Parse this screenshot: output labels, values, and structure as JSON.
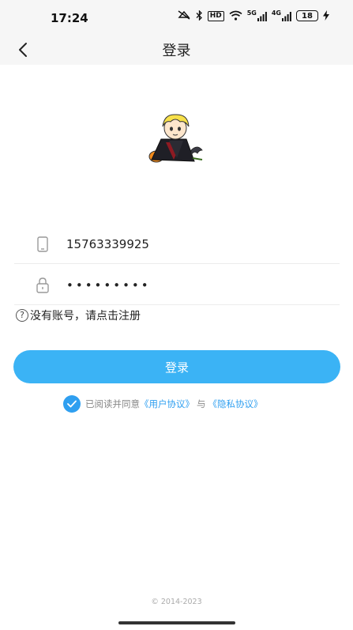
{
  "status_bar": {
    "time": "17:24",
    "network_labels": [
      "HD",
      "5G",
      "4G"
    ],
    "battery": "18",
    "icons": [
      "silent-icon",
      "bluetooth-icon",
      "wifi-icon",
      "signal-icon",
      "charging-icon"
    ]
  },
  "navbar": {
    "title": "登录",
    "back_icon": "chevron-left-icon"
  },
  "form": {
    "phone_value": "15763339925",
    "password_value": "•••••••••",
    "phone_icon": "phone-icon",
    "lock_icon": "lock-icon"
  },
  "register": {
    "text": "没有账号，请点击注册",
    "icon": "question-circle-icon"
  },
  "login_button": "登录",
  "agreement": {
    "checked": true,
    "prefix": "已阅读并同意",
    "user_agreement": "《用户协议》",
    "and": "与",
    "privacy_policy": "《隐私协议》"
  },
  "copyright": "© 2014-2023",
  "colors": {
    "accent": "#3bb3f5",
    "link": "#2f9ff0",
    "bar_bg": "#f6f6f6"
  }
}
